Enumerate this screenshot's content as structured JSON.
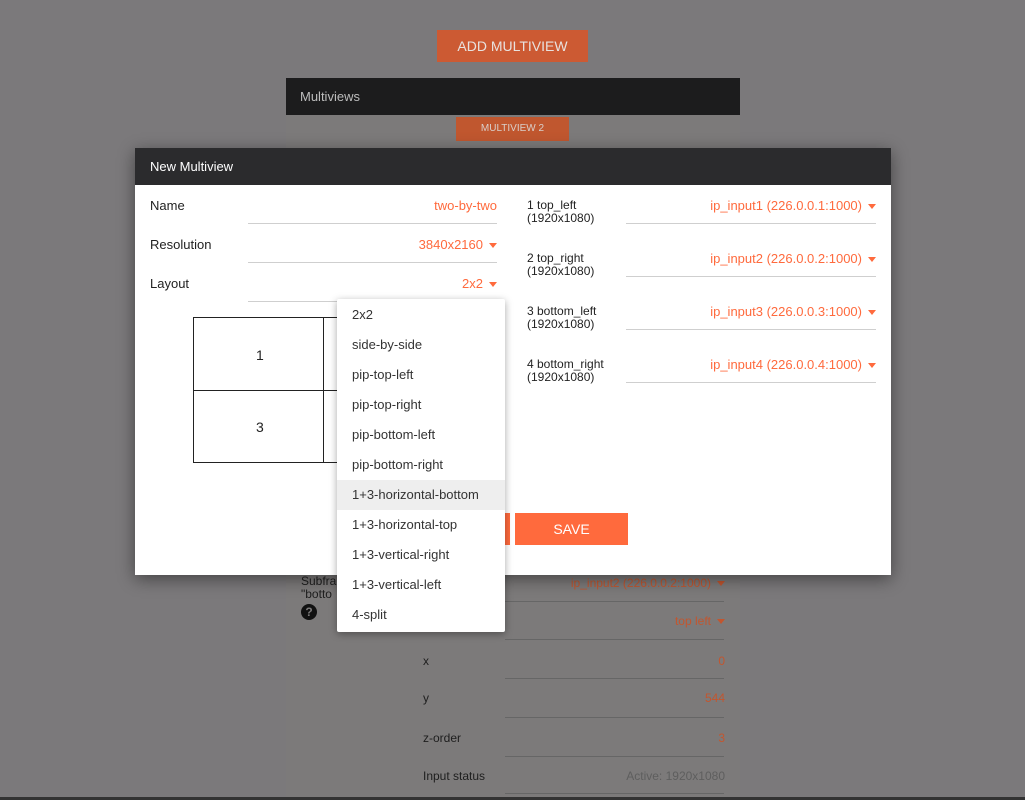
{
  "background": {
    "add_button": "ADD MULTIVIEW",
    "panel_title": "Multiviews",
    "tab_label": "MULTIVIEW 2",
    "subframe_label_1": "Subfra",
    "subframe_label_2": "\"botto",
    "subframe_input": "ip_input2 (226.0.0.2:1000)",
    "position_value": "top left",
    "rows": [
      {
        "label": "x",
        "value": "0"
      },
      {
        "label": "y",
        "value": "544"
      },
      {
        "label": "z-order",
        "value": "3"
      },
      {
        "label": "Input status",
        "value": "Active: 1920x1080"
      }
    ],
    "help_icon": "?"
  },
  "modal": {
    "title": "New Multiview",
    "fields": {
      "name": {
        "label": "Name",
        "value": "two-by-two"
      },
      "resolution": {
        "label": "Resolution",
        "value": "3840x2160"
      },
      "layout": {
        "label": "Layout",
        "value": "2x2"
      }
    },
    "preview_cells": [
      "1",
      "3"
    ],
    "outputs": [
      {
        "label": "1 top_left",
        "res": "(1920x1080)",
        "value": "ip_input1 (226.0.0.1:1000)"
      },
      {
        "label": "2 top_right",
        "res": "(1920x1080)",
        "value": "ip_input2 (226.0.0.2:1000)"
      },
      {
        "label": "3 bottom_left",
        "res": "(1920x1080)",
        "value": "ip_input3 (226.0.0.3:1000)"
      },
      {
        "label": "4 bottom_right",
        "res": "(1920x1080)",
        "value": "ip_input4 (226.0.0.4:1000)"
      }
    ],
    "save_label": "SAVE"
  },
  "layout_dropdown": {
    "options": [
      "2x2",
      "side-by-side",
      "pip-top-left",
      "pip-top-right",
      "pip-bottom-left",
      "pip-bottom-right",
      "1+3-horizontal-bottom",
      "1+3-horizontal-top",
      "1+3-vertical-right",
      "1+3-vertical-left",
      "4-split"
    ],
    "highlighted": "1+3-horizontal-bottom"
  },
  "colors": {
    "accent": "#ff6a3d",
    "overlay": "#7b797b",
    "header_dark": "#2b2b2d"
  }
}
